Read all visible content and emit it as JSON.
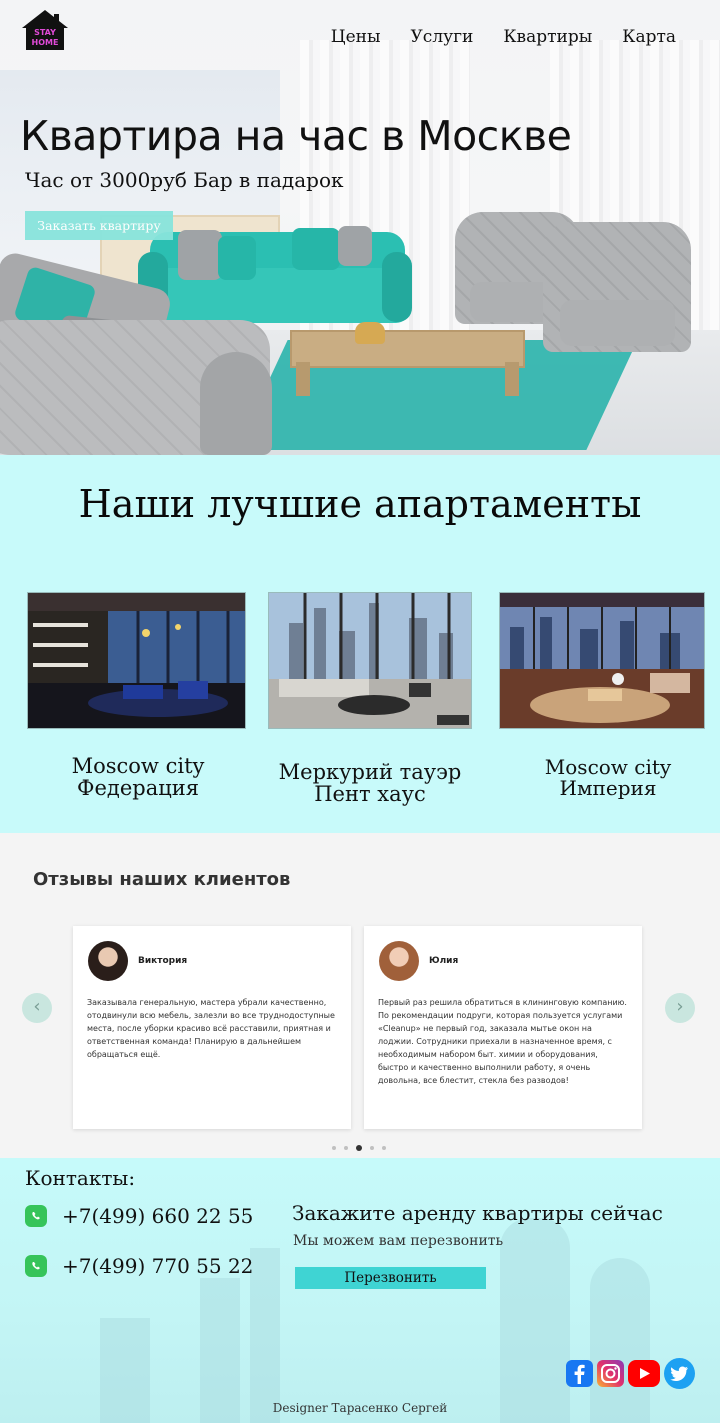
{
  "header": {
    "logo_text_1": "STAY",
    "logo_text_2": "HOME",
    "nav": [
      "Цены",
      "Услуги",
      "Квартиры",
      "Карта"
    ]
  },
  "hero": {
    "title": "Квартира на час в Москве",
    "subtitle": "Час от 3000руб Бар в падарок",
    "button": "Заказать квартиру"
  },
  "apartments": {
    "title": "Наши лучшие апартаменты",
    "items": [
      {
        "line1": "Moscow city",
        "line2": "Федерация"
      },
      {
        "line1": "Меркурий тауэр",
        "line2": "Пент хаус"
      },
      {
        "line1": "Moscow city",
        "line2": "Империя"
      }
    ]
  },
  "reviews": {
    "title": "Отзывы наших клиентов",
    "items": [
      {
        "name": "Виктория",
        "text": "Заказывала генеральную, мастера убрали качественно, отодвинули всю мебель, залезли во все труднодоступные места, после уборки красиво всё расставили, приятная и ответственная команда! Планирую в дальнейшем обращаться ещё."
      },
      {
        "name": "Юлия",
        "text": "Первый раз решила обратиться в клининговую компанию. По рекомендации подруги, которая пользуется услугами «Cleanup» не первый год, заказала мытье окон на лоджии. Сотрудники приехали в назначенное время, с необходимым набором быт. химии и оборудования, быстро и качественно выполнили работу, я очень довольна, все блестит, стекла без разводов!"
      }
    ],
    "prev": "‹",
    "next": "›",
    "active_dot_index": 2
  },
  "contacts": {
    "title": "Контакты:",
    "phones": [
      "+7(499) 660 22 55",
      "+7(499) 770 55 22"
    ],
    "cta_title": "Закажите аренду квартиры сейчас",
    "cta_subtitle": "Мы можем вам перезвонить",
    "callback_button": "Перезвонить",
    "socials": [
      "facebook-icon",
      "instagram-icon",
      "youtube-icon",
      "twitter-icon"
    ],
    "designer": "Designer Тарасенко Сергей"
  }
}
